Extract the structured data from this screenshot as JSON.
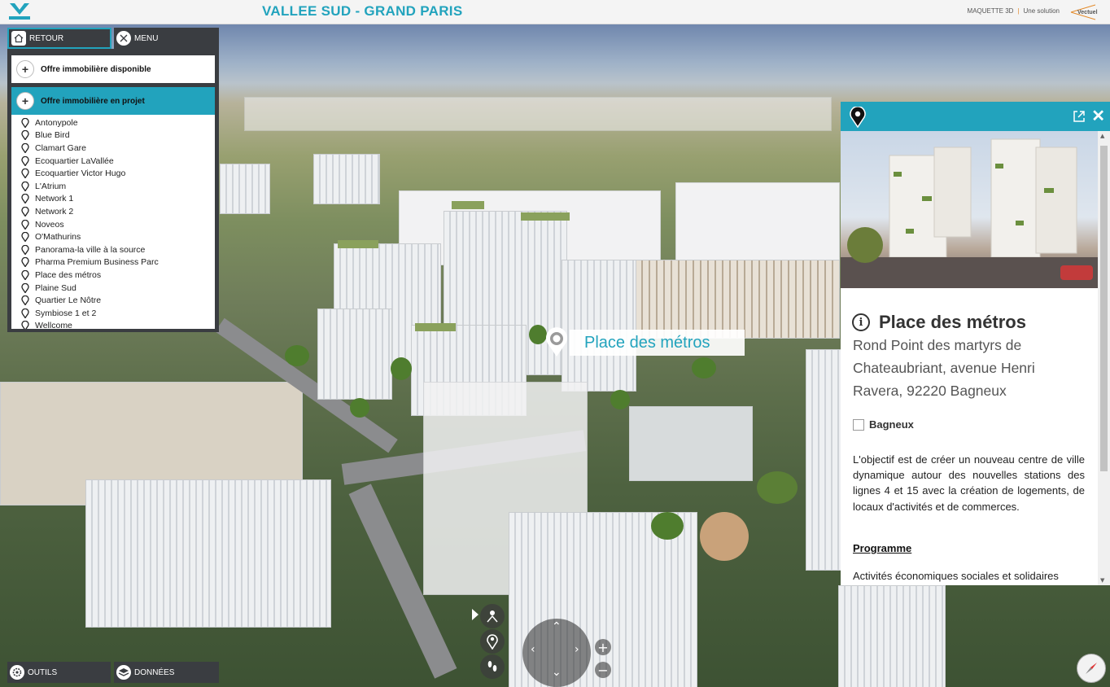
{
  "header": {
    "title": "VALLEE SUD - GRAND PARIS",
    "brand_product": "MAQUETTE 3D",
    "brand_tagline": "Une solution",
    "brand_name": "Vectuel",
    "logo_text": "VALLEE SUD"
  },
  "toolbar": {
    "retour_label": "RETOUR",
    "menu_label": "MENU",
    "outils_label": "OUTILS",
    "donnees_label": "DONNÉES"
  },
  "menu": {
    "offre_disponible": "Offre immobilière disponible",
    "offre_projet": "Offre immobilière en projet",
    "items": [
      "Antonypole",
      "Blue Bird",
      "Clamart Gare",
      "Ecoquartier LaVallée",
      "Ecoquartier Victor Hugo",
      "L'Atrium",
      "Network 1",
      "Network 2",
      "Noveos",
      "O'Mathurins",
      "Panorama-la ville à la source",
      "Pharma Premium Business Parc",
      "Place des métros",
      "Plaine Sud",
      "Quartier Le Nôtre",
      "Symbiose 1 et 2",
      "Wellcome"
    ]
  },
  "map": {
    "label": "Place des métros"
  },
  "info": {
    "title": "Place des métros",
    "address": "Rond Point des martyrs de Chateaubriant, avenue Henri Ravera, 92220 Bagneux",
    "city": "Bagneux",
    "description": "L'objectif est de créer un nouveau centre de ville dynamique autour des nouvelles stations des lignes 4 et 15 avec la création de logements, de locaux d'activités et de commerces.",
    "programme_heading": "Programme",
    "programme_first": "Activités économiques sociales et solidaires"
  },
  "colors": {
    "accent": "#22a3bd",
    "panel_dark": "#3a3d41"
  }
}
